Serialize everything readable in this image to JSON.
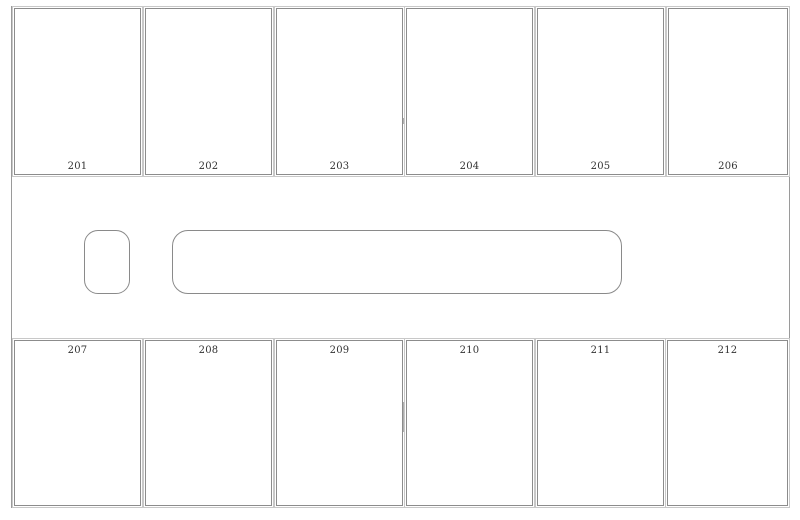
{
  "rooms": {
    "top": [
      {
        "number": "201"
      },
      {
        "number": "202"
      },
      {
        "number": "203"
      },
      {
        "number": "204"
      },
      {
        "number": "205"
      },
      {
        "number": "206"
      }
    ],
    "bottom": [
      {
        "number": "207"
      },
      {
        "number": "208"
      },
      {
        "number": "209"
      },
      {
        "number": "210"
      },
      {
        "number": "211"
      },
      {
        "number": "212"
      }
    ]
  },
  "colors": {
    "wall": "#8c8c8c",
    "background": "#ffffff",
    "label": "#333333"
  }
}
